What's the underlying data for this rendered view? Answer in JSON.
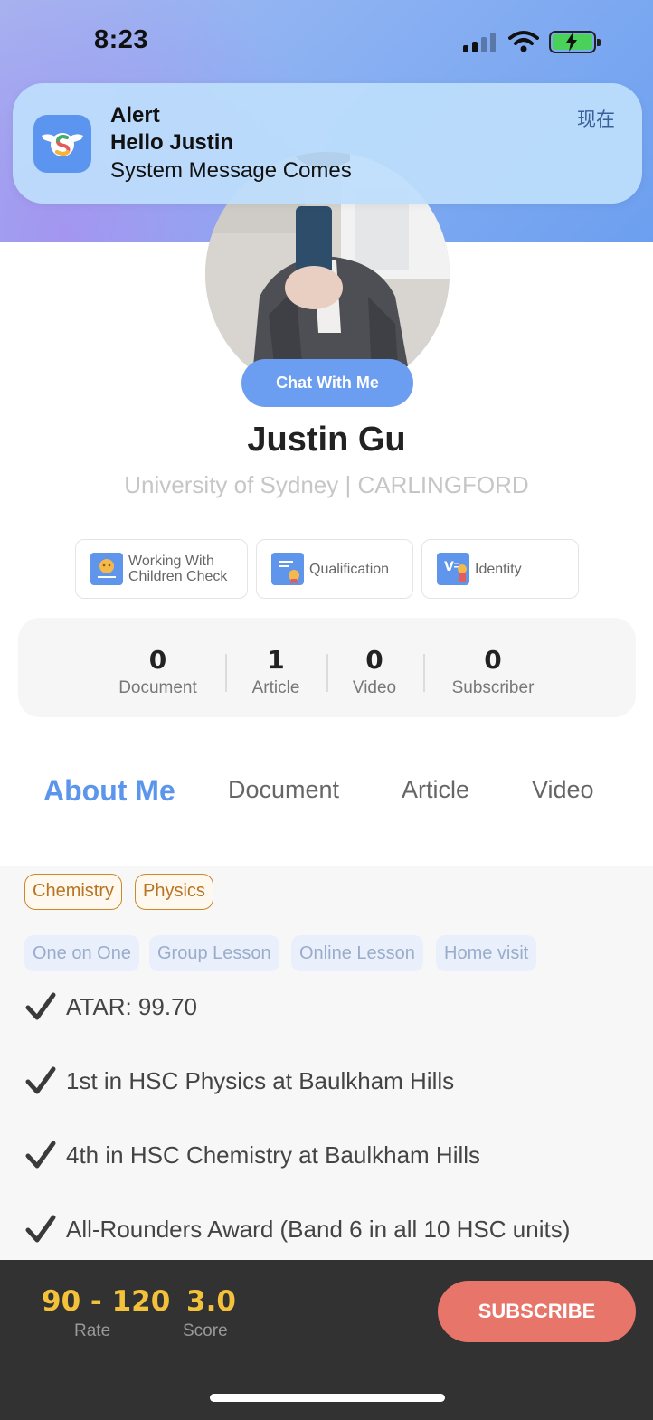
{
  "status_bar": {
    "time": "8:23"
  },
  "notification": {
    "title": "Alert",
    "line2": "Hello Justin",
    "line3": "System Message Comes",
    "time": "现在"
  },
  "profile": {
    "chat_button": "Chat With Me",
    "name": "Justin Gu",
    "subtitle": "University of Sydney | CARLINGFORD"
  },
  "credentials": [
    {
      "label_line1": "Working With",
      "label_line2": "Children Check"
    },
    {
      "label_line1": "Qualification"
    },
    {
      "label_line1": "Identity"
    }
  ],
  "stats": [
    {
      "value": "0",
      "label": "Document"
    },
    {
      "value": "1",
      "label": "Article"
    },
    {
      "value": "0",
      "label": "Video"
    },
    {
      "value": "0",
      "label": "Subscriber"
    }
  ],
  "tabs": [
    {
      "label": "About Me",
      "active": true
    },
    {
      "label": "Document"
    },
    {
      "label": "Article"
    },
    {
      "label": "Video"
    }
  ],
  "subjects": [
    "Chemistry",
    "Physics"
  ],
  "lesson_modes": [
    "One on One",
    "Group Lesson",
    "Online Lesson",
    "Home visit"
  ],
  "achievements": [
    "ATAR: 99.70",
    "1st in HSC Physics at Baulkham Hills",
    "4th in HSC Chemistry at Baulkham Hills",
    "All-Rounders Award (Band 6 in all 10 HSC units)"
  ],
  "bottom_bar": {
    "rate_value": "90 - 120",
    "rate_label": "Rate",
    "score_value": "3.0",
    "score_label": "Score",
    "subscribe_button": "SUBSCRIBE"
  },
  "colors": {
    "accent_blue": "#5c96ec",
    "subject_tag": "#c8892c",
    "rate_gold": "#f4c23a",
    "subscribe": "#e8756a",
    "bottom_bar": "#323232"
  }
}
